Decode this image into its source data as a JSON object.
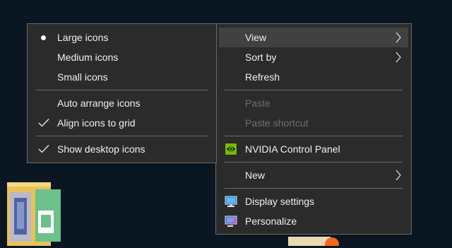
{
  "colors": {
    "desktop": "#0b1623",
    "menu_bg": "#2b2b2b",
    "menu_border": "#6a6a6a",
    "hover": "#414141",
    "text": "#f0f0f0",
    "disabled_text": "#6d6d6d",
    "nvidia_green": "#76b900"
  },
  "context_menu": {
    "view": {
      "label": "View",
      "icon": "chevron-right-icon"
    },
    "sort_by": {
      "label": "Sort by",
      "icon": "chevron-right-icon"
    },
    "refresh": {
      "label": "Refresh"
    },
    "paste": {
      "label": "Paste",
      "disabled": true
    },
    "paste_shortcut": {
      "label": "Paste shortcut",
      "disabled": true
    },
    "nvidia": {
      "label": "NVIDIA Control Panel",
      "icon": "nvidia-icon"
    },
    "new": {
      "label": "New",
      "icon": "chevron-right-icon"
    },
    "display_settings": {
      "label": "Display settings",
      "icon": "display-settings-icon"
    },
    "personalize": {
      "label": "Personalize",
      "icon": "personalize-icon"
    }
  },
  "view_submenu": {
    "large_icons": {
      "label": "Large icons",
      "selected": true
    },
    "medium_icons": {
      "label": "Medium icons"
    },
    "small_icons": {
      "label": "Small icons"
    },
    "auto_arrange": {
      "label": "Auto arrange icons",
      "checked": false
    },
    "align_to_grid": {
      "label": "Align icons to grid",
      "checked": true
    },
    "show_desktop_icons": {
      "label": "Show desktop icons",
      "checked": true
    }
  }
}
